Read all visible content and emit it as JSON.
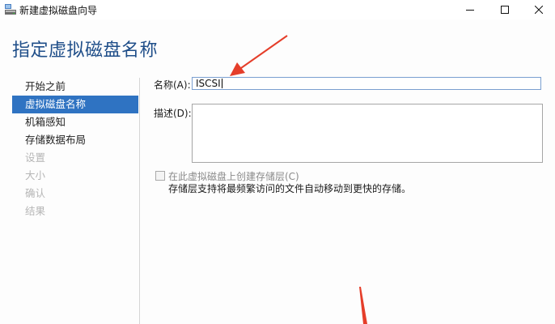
{
  "window": {
    "title": "新建虚拟磁盘向导"
  },
  "page": {
    "heading": "指定虚拟磁盘名称"
  },
  "nav": {
    "items": [
      {
        "label": "开始之前"
      },
      {
        "label": "虚拟磁盘名称"
      },
      {
        "label": "机箱感知"
      },
      {
        "label": "存储数据布局"
      },
      {
        "label": "设置"
      },
      {
        "label": "大小"
      },
      {
        "label": "确认"
      },
      {
        "label": "结果"
      }
    ]
  },
  "form": {
    "name_label": "名称(A):",
    "name_value": "ISCSI",
    "description_label": "描述(D):",
    "description_value": "",
    "tier_checkbox_label": "在此虚拟磁盘上创建存储层(C)",
    "tier_checkbox_checked": false,
    "tier_description": "存储层支持将最频繁访问的文件自动移动到更快的存储。"
  },
  "colors": {
    "accent": "#2f73c2",
    "heading": "#1f4e89",
    "annotation_arrow": "#e53e2a"
  }
}
